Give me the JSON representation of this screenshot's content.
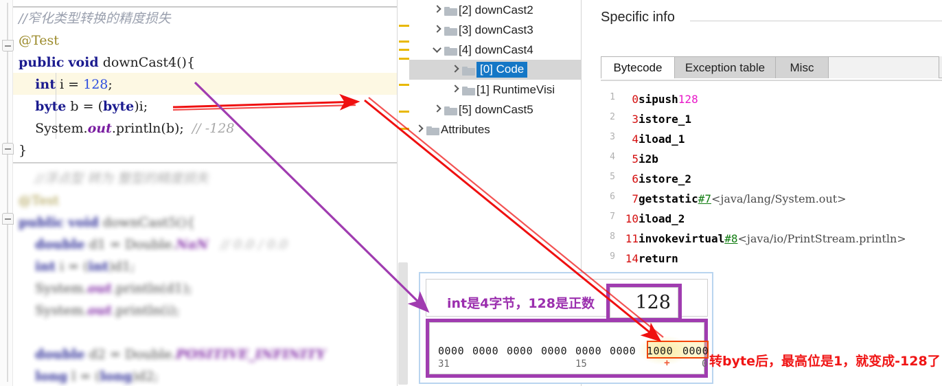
{
  "editor": {
    "lines": [
      {
        "tokens": [
          {
            "t": "//窄化类型转换的精度损失",
            "c": "comment-cn"
          }
        ]
      },
      {
        "tokens": [
          {
            "t": "@Test",
            "c": "anno"
          }
        ]
      },
      {
        "tokens": [
          {
            "t": "public",
            "c": "kw"
          },
          {
            "t": " ",
            "c": ""
          },
          {
            "t": "void",
            "c": "kw"
          },
          {
            "t": " downCast4(){",
            "c": ""
          }
        ]
      },
      {
        "tokens": [
          {
            "t": "    ",
            "c": ""
          },
          {
            "t": "int",
            "c": "kw"
          },
          {
            "t": " i = ",
            "c": ""
          },
          {
            "t": "128",
            "c": "num"
          },
          {
            "t": ";",
            "c": ""
          }
        ]
      },
      {
        "tokens": [
          {
            "t": "    ",
            "c": ""
          },
          {
            "t": "byte",
            "c": "kw"
          },
          {
            "t": " b = (",
            "c": ""
          },
          {
            "t": "byte",
            "c": "kw"
          },
          {
            "t": ")i;",
            "c": ""
          }
        ]
      },
      {
        "tokens": [
          {
            "t": "    System.",
            "c": ""
          },
          {
            "t": "out",
            "c": "field-italic"
          },
          {
            "t": ".println(b);  ",
            "c": ""
          },
          {
            "t": "// -128",
            "c": "comment-gray"
          }
        ]
      },
      {
        "tokens": [
          {
            "t": "}",
            "c": ""
          }
        ]
      }
    ],
    "blurred_lines": [
      {
        "tokens": [
          {
            "t": "    //浮点型 转为 整型的精度损失",
            "c": "comment-gray"
          }
        ]
      },
      {
        "tokens": [
          {
            "t": "@Test",
            "c": "anno"
          }
        ]
      },
      {
        "tokens": [
          {
            "t": "public",
            "c": "kw"
          },
          {
            "t": " ",
            "c": ""
          },
          {
            "t": "void",
            "c": "kw"
          },
          {
            "t": " downCast5(){",
            "c": ""
          }
        ]
      },
      {
        "tokens": [
          {
            "t": "    ",
            "c": ""
          },
          {
            "t": "double",
            "c": "kw"
          },
          {
            "t": " d1 = Double.",
            "c": ""
          },
          {
            "t": "NaN",
            "c": "field-italic"
          },
          {
            "t": "   // 0.0 / 0.0",
            "c": "comment-gray"
          }
        ]
      },
      {
        "tokens": [
          {
            "t": "    ",
            "c": ""
          },
          {
            "t": "int",
            "c": "kw"
          },
          {
            "t": " i = (",
            "c": ""
          },
          {
            "t": "int",
            "c": "kw"
          },
          {
            "t": ")d1;",
            "c": ""
          }
        ]
      },
      {
        "tokens": [
          {
            "t": "    System.",
            "c": ""
          },
          {
            "t": "out",
            "c": "field-italic"
          },
          {
            "t": ".println(d1);",
            "c": ""
          }
        ]
      },
      {
        "tokens": [
          {
            "t": "    System.",
            "c": ""
          },
          {
            "t": "out",
            "c": "field-italic"
          },
          {
            "t": ".println(i);",
            "c": ""
          }
        ]
      },
      {
        "tokens": [
          {
            "t": "",
            "c": ""
          }
        ]
      },
      {
        "tokens": [
          {
            "t": "    ",
            "c": ""
          },
          {
            "t": "double",
            "c": "kw"
          },
          {
            "t": " d2 = Double.",
            "c": ""
          },
          {
            "t": "POSITIVE_INFINITY",
            "c": "field-italic"
          }
        ]
      },
      {
        "tokens": [
          {
            "t": "    ",
            "c": ""
          },
          {
            "t": "long",
            "c": "kw"
          },
          {
            "t": " l = (",
            "c": ""
          },
          {
            "t": "long",
            "c": "kw"
          },
          {
            "t": ")d2;",
            "c": ""
          }
        ]
      }
    ],
    "gutter_marks_label": "modified-lines"
  },
  "tree": {
    "items": [
      {
        "label": "[2] downCast2",
        "indent": 1,
        "twisty": "closed",
        "selected": false,
        "highlight": false
      },
      {
        "label": "[3] downCast3",
        "indent": 1,
        "twisty": "closed",
        "selected": false,
        "highlight": false
      },
      {
        "label": "[4] downCast4",
        "indent": 1,
        "twisty": "open",
        "selected": false,
        "highlight": false
      },
      {
        "label": "[0] Code",
        "indent": 2,
        "twisty": "closed",
        "selected": true,
        "highlight": true
      },
      {
        "label": "[1] RuntimeVisi",
        "indent": 2,
        "twisty": "closed",
        "selected": false,
        "highlight": false
      },
      {
        "label": "[5] downCast5",
        "indent": 1,
        "twisty": "closed",
        "selected": false,
        "highlight": false
      },
      {
        "label": "Attributes",
        "indent": 0,
        "twisty": "closed",
        "selected": false,
        "highlight": false
      }
    ]
  },
  "info": {
    "title": "Specific info",
    "tabs": [
      {
        "label": "Bytecode",
        "active": true
      },
      {
        "label": "Exception table",
        "active": false
      },
      {
        "label": "Misc",
        "active": false
      }
    ],
    "bytecode": [
      {
        "n": "1",
        "offset": "0",
        "op": "sipush",
        "int": "128",
        "ref": "",
        "desc": ""
      },
      {
        "n": "2",
        "offset": "3",
        "op": "istore_1",
        "int": "",
        "ref": "",
        "desc": ""
      },
      {
        "n": "3",
        "offset": "4",
        "op": "iload_1",
        "int": "",
        "ref": "",
        "desc": ""
      },
      {
        "n": "4",
        "offset": "5",
        "op": "i2b",
        "int": "",
        "ref": "",
        "desc": ""
      },
      {
        "n": "5",
        "offset": "6",
        "op": "istore_2",
        "int": "",
        "ref": "",
        "desc": ""
      },
      {
        "n": "6",
        "offset": "7",
        "op": "getstatic",
        "int": "",
        "ref": "#7",
        "desc": "<java/lang/System.out>"
      },
      {
        "n": "7",
        "offset": "10",
        "op": "iload_2",
        "int": "",
        "ref": "",
        "desc": ""
      },
      {
        "n": "8",
        "offset": "11",
        "op": "invokevirtual",
        "int": "",
        "ref": "#8",
        "desc": "<java/io/PrintStream.println>"
      },
      {
        "n": "9",
        "offset": "14",
        "op": "return",
        "int": "",
        "ref": "",
        "desc": ""
      }
    ]
  },
  "callout": {
    "note": "int是4字节，128是正数",
    "value": "128",
    "bit_groups": [
      "0000",
      "0000",
      "0000",
      "0000",
      "0000",
      "0000",
      "1000",
      "0000"
    ],
    "bit_labels": [
      {
        "text": "31",
        "group": 0
      },
      {
        "text": "15",
        "group": 4
      },
      {
        "text": "0",
        "group": 7
      }
    ],
    "plus_marker": "+",
    "right_note": "转byte后，最高位是1，就变成-128了"
  },
  "colors": {
    "tree_selection": "#1577c6",
    "purple_annotation": "#9b2fae",
    "red_annotation": "#f01515",
    "bit_highlight": "#f24405",
    "gutter_mark": "#e8b800",
    "keyword": "#1b1b8f",
    "bytecode_offset": "#d40f0f",
    "bytecode_int": "#e818c8",
    "bytecode_ref": "#127d12"
  }
}
